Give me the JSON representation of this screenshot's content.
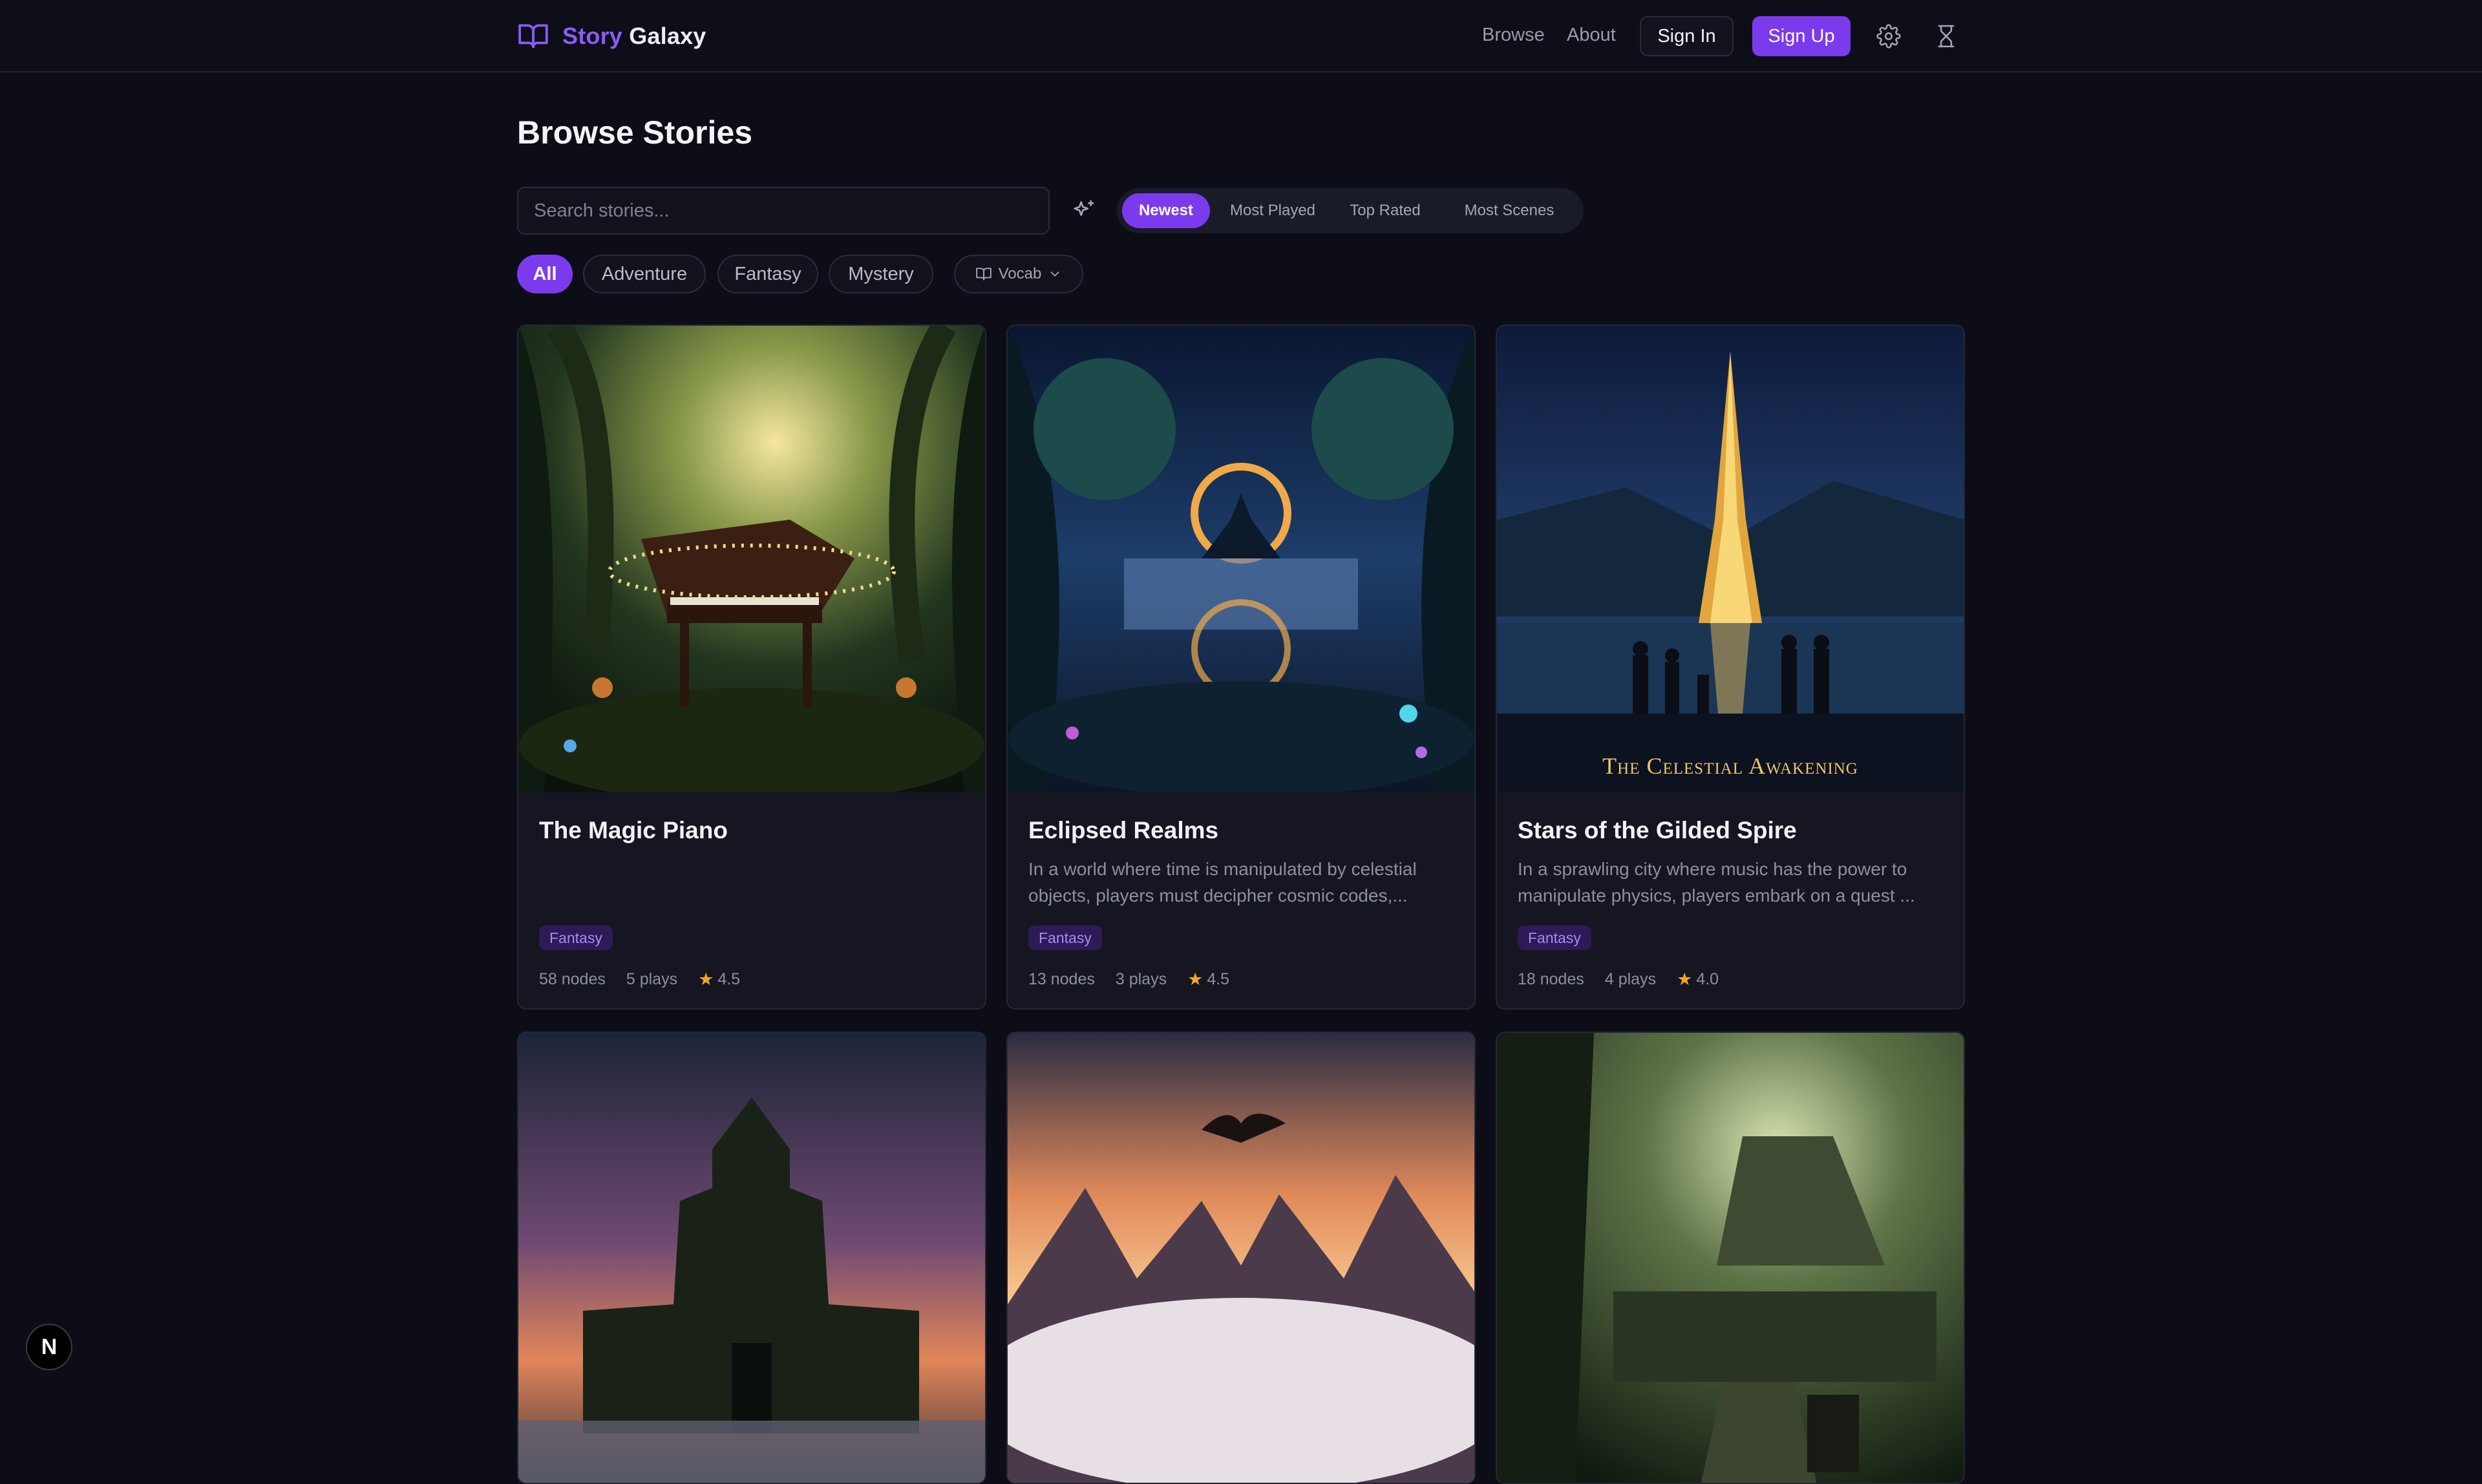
{
  "header": {
    "brand_story": "Story",
    "brand_galaxy": "Galaxy",
    "nav_browse": "Browse",
    "nav_about": "About",
    "sign_in": "Sign In",
    "sign_up": "Sign Up",
    "icons": [
      "book-icon",
      "settings-gear-icon",
      "hourglass-icon"
    ]
  },
  "page": {
    "title": "Browse Stories",
    "search_placeholder": "Search stories...",
    "sort": [
      "Newest",
      "Most Played",
      "Top Rated",
      "Most Scenes"
    ],
    "sort_active": "Newest",
    "filters": [
      "All",
      "Adventure",
      "Fantasy",
      "Mystery"
    ],
    "filter_active": "All",
    "vocab_label": "Vocab"
  },
  "cards": [
    {
      "title": "The Magic Piano",
      "description": "",
      "tag": "Fantasy",
      "nodes": "58 nodes",
      "plays": "5 plays",
      "rating": "4.5"
    },
    {
      "title": "Eclipsed Realms",
      "description": "In a world where time is manipulated by celestial objects, players must decipher cosmic codes,...",
      "tag": "Fantasy",
      "nodes": "13 nodes",
      "plays": "3 plays",
      "rating": "4.5"
    },
    {
      "title": "Stars of the Gilded Spire",
      "description": "In a sprawling city where music has the power to manipulate physics, players embark on a quest ...",
      "tag": "Fantasy",
      "nodes": "18 nodes",
      "plays": "4 plays",
      "rating": "4.0",
      "image_caption": "The Celestial Awakening"
    }
  ],
  "colors": {
    "accent": "#7c3aed",
    "background": "#0c0d16",
    "card": "#151622",
    "star": "#f5a623"
  },
  "dev_badge": "N"
}
